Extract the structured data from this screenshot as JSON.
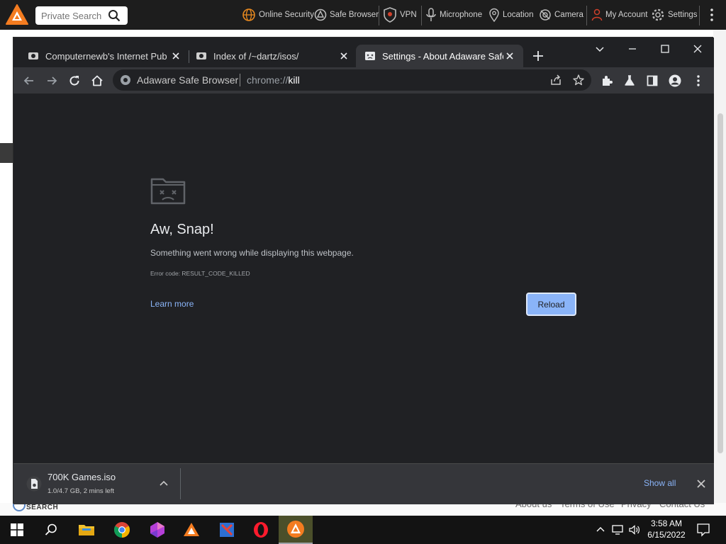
{
  "adaware_bar": {
    "search_placeholder": "Private Search",
    "items": [
      {
        "label": "Online Security",
        "icon": "globe-icon"
      },
      {
        "label": "Safe Browser",
        "icon": "safe-browser-icon"
      },
      {
        "label": "VPN",
        "icon": "vpn-shield-icon"
      },
      {
        "label": "Microphone",
        "icon": "microphone-icon"
      },
      {
        "label": "Location",
        "icon": "location-pin-icon"
      },
      {
        "label": "Camera",
        "icon": "camera-icon"
      },
      {
        "label": "My Account",
        "icon": "user-icon"
      },
      {
        "label": "Settings",
        "icon": "gear-icon"
      }
    ],
    "brand_color": "#f47c20"
  },
  "browser": {
    "tabs": [
      {
        "title": "Computernewb's Internet Pub Hub",
        "icon": "site-favicon",
        "active": false
      },
      {
        "title": "Index of /~dartz/isos/",
        "icon": "site-favicon",
        "active": false
      },
      {
        "title": "Settings - About Adaware Safe Browser",
        "icon": "sad-tab-favicon",
        "active": true
      }
    ],
    "omnibox": {
      "site_name": "Adaware Safe Browser",
      "url_scheme": "chrome://",
      "url_path": "kill"
    }
  },
  "error_page": {
    "title": "Aw, Snap!",
    "message": "Something went wrong while displaying this webpage.",
    "error_code": "Error code: RESULT_CODE_KILLED",
    "learn_more": "Learn more",
    "reload": "Reload",
    "accent_color": "#8ab4f8"
  },
  "downloads": {
    "file_name": "700K Games.iso",
    "status": "1.0/4.7 GB, 2 mins left",
    "show_all": "Show all"
  },
  "background_page": {
    "search_label": "SEARCH",
    "footer_links": [
      "About us",
      "Terms of Use",
      "Privacy",
      "Contact Us"
    ]
  },
  "taskbar": {
    "time": "3:58 AM",
    "date": "6/15/2022",
    "apps": [
      "search-icon",
      "file-explorer-icon",
      "chrome-icon",
      "app-icon",
      "adaware-icon",
      "app-icon",
      "opera-icon",
      "adaware-browser-icon"
    ]
  }
}
